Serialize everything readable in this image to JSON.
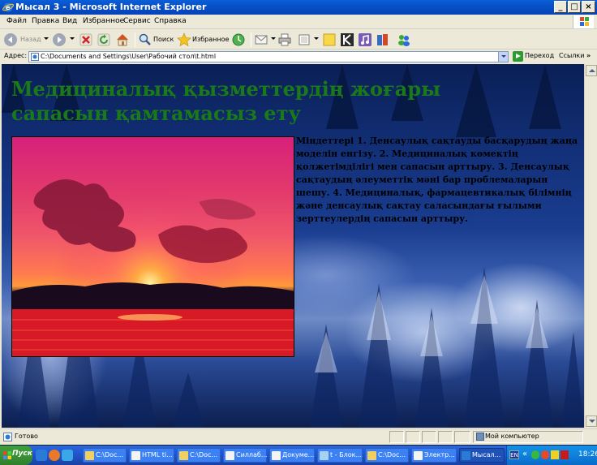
{
  "window": {
    "title": "Мысал 3 - Microsoft Internet Explorer",
    "controls": {
      "minimize": "_",
      "maximize": "□",
      "close": "×"
    }
  },
  "menu": [
    "Файл",
    "Правка",
    "Вид",
    "Избранное",
    "Сервис",
    "Справка"
  ],
  "toolbar": {
    "back_label": "Назад",
    "search_label": "Поиск",
    "favorites_label": "Избранное"
  },
  "address": {
    "label": "Адрес:",
    "value": "C:\\Documents and Settings\\User\\Рабочий стол\\t.html",
    "go_label": "Переход",
    "links_label": "Ссылки",
    "links_chevron": "»"
  },
  "page": {
    "heading": "Медициналық қызметтердің жоғары сапасын қамтамасыз ету",
    "paragraph": "Міндеттері 1. Денсаулық сақтауды басқарудың жаңа моделін енгізу. 2. Медициналық көмектің қолжетімділігі мен сапасын арттыру. 3. Денсаулық сақтаудың әлеуметтік мәні бар проблемаларын шешу. 4. Медициналық, фармацевтикалық білімнің және денсаулық сақтау саласындағы ғылыми зерттеулердің сапасын арттыру."
  },
  "status": {
    "text": "Готово",
    "zone": "Мой компьютер"
  },
  "taskbar": {
    "start_label": "Пуск",
    "tasks": [
      {
        "label": "C:\\Doc...",
        "active": false
      },
      {
        "label": "HTML ti...",
        "active": false
      },
      {
        "label": "C:\\Doc...",
        "active": false
      },
      {
        "label": "Силлаб...",
        "active": false
      },
      {
        "label": "Докуме...",
        "active": false
      },
      {
        "label": "t - Блок...",
        "active": false
      },
      {
        "label": "C:\\Doc...",
        "active": false
      },
      {
        "label": "Электр...",
        "active": false
      },
      {
        "label": "Мысал...",
        "active": true
      }
    ],
    "tray_lang": "EN",
    "tray_chevron": "«",
    "clock": "18:26"
  },
  "colors": {
    "heading": "#1a7a1a",
    "titlebar": "#0851c7",
    "taskbar": "#245edb",
    "start": "#3b9838"
  }
}
